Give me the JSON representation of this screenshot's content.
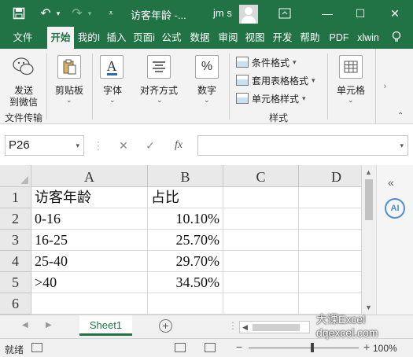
{
  "titlebar": {
    "title": "访客年龄 -...",
    "user": "jm s",
    "min": "—",
    "max": "☐",
    "close": "✕"
  },
  "tabs": [
    {
      "label": "文件",
      "active": false
    },
    {
      "label": "开始",
      "active": true
    },
    {
      "label": "我的I",
      "active": false
    },
    {
      "label": "插入",
      "active": false
    },
    {
      "label": "页面i",
      "active": false
    },
    {
      "label": "公式",
      "active": false
    },
    {
      "label": "数据",
      "active": false
    },
    {
      "label": "审阅",
      "active": false
    },
    {
      "label": "视图",
      "active": false
    },
    {
      "label": "开发",
      "active": false
    },
    {
      "label": "帮助",
      "active": false
    },
    {
      "label": "PDF",
      "active": false
    },
    {
      "label": "xlwin",
      "active": false
    }
  ],
  "ribbon": {
    "send_wechat_line1": "发送",
    "send_wechat_line2": "到微信",
    "file_transfer_group": "文件传输",
    "clipboard": "剪贴板",
    "font": "字体",
    "alignment": "对齐方式",
    "number": "数字",
    "conditional_format": "条件格式",
    "table_format": "套用表格格式",
    "cell_style": "单元格样式",
    "styles_group": "样式",
    "cells": "单元格"
  },
  "formula_bar": {
    "name_box": "P26",
    "cancel": "✕",
    "enter": "✓",
    "fx": "fx",
    "formula": ""
  },
  "grid": {
    "columns": [
      "A",
      "B",
      "C",
      "D"
    ],
    "rows": [
      "1",
      "2",
      "3",
      "4",
      "5",
      "6"
    ],
    "cells": [
      [
        "访客年龄",
        "占比",
        "",
        ""
      ],
      [
        "0-16",
        "10.10%",
        "",
        ""
      ],
      [
        "16-25",
        "25.70%",
        "",
        ""
      ],
      [
        "25-40",
        "29.70%",
        "",
        ""
      ],
      [
        ">40",
        "34.50%",
        "",
        ""
      ],
      [
        "",
        "",
        "",
        ""
      ]
    ]
  },
  "side_panel": {
    "ai_label": "AI"
  },
  "sheets": {
    "active": "Sheet1",
    "add": "+"
  },
  "status": {
    "text": "就绪",
    "zoom": "100%"
  },
  "watermark": {
    "line1": "大课Excel",
    "line2": "dqexcel.com"
  }
}
